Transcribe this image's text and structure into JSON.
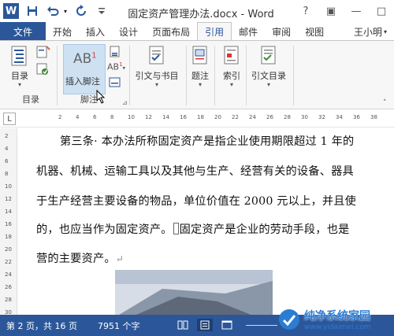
{
  "window": {
    "title": "固定资产管理办法.docx - Word",
    "help": "?",
    "ribbon_display": "▣",
    "minimize": "—",
    "restore": "□"
  },
  "tabs": [
    {
      "label": "文件"
    },
    {
      "label": "开始"
    },
    {
      "label": "插入"
    },
    {
      "label": "设计"
    },
    {
      "label": "页面布局"
    },
    {
      "label": "引用"
    },
    {
      "label": "邮件"
    },
    {
      "label": "审阅"
    },
    {
      "label": "视图"
    }
  ],
  "user": {
    "name": "王小明"
  },
  "ribbon": {
    "toc": {
      "label": "目录",
      "group": "目录"
    },
    "insert_footnote": {
      "label": "插入脚注",
      "icon_text": "AB",
      "superscript": "1"
    },
    "footnote_group": "脚注",
    "next_footnote_text": "AB",
    "citations": {
      "label": "引文与书目"
    },
    "captions": {
      "label": "题注"
    },
    "index": {
      "label": "索引"
    },
    "toa": {
      "label": "引文目录"
    }
  },
  "ruler": {
    "corner": "L",
    "h_numbers": [
      "2",
      "4",
      "6",
      "8",
      "10",
      "12",
      "14",
      "16",
      "18",
      "20",
      "22",
      "24",
      "26",
      "28",
      "30",
      "32",
      "34",
      "36",
      "38"
    ],
    "v_numbers": [
      "2",
      "4",
      "6",
      "8",
      "10",
      "12",
      "14",
      "16",
      "18",
      "20",
      "22",
      "24",
      "26",
      "28",
      "30"
    ]
  },
  "document": {
    "lines": [
      "第三条· 本办法所称固定资产是指企业使用期限超过 1 年的",
      "机器、机械、运输工具以及其他与生产、经营有关的设备、器具",
      "于生产经营主要设备的物品，单位价值在 2000 元以上，并且使",
      "的，也应当作为固定资产。",
      "营的主要资产。"
    ],
    "line4_after_mark": "固定资产是企业的劳动手段，也是"
  },
  "status": {
    "page": "第 2 页，共 16 页",
    "words": "7951 个字"
  },
  "watermark": {
    "text": "纯净系统家园",
    "url": "www.yidaimei.com"
  }
}
